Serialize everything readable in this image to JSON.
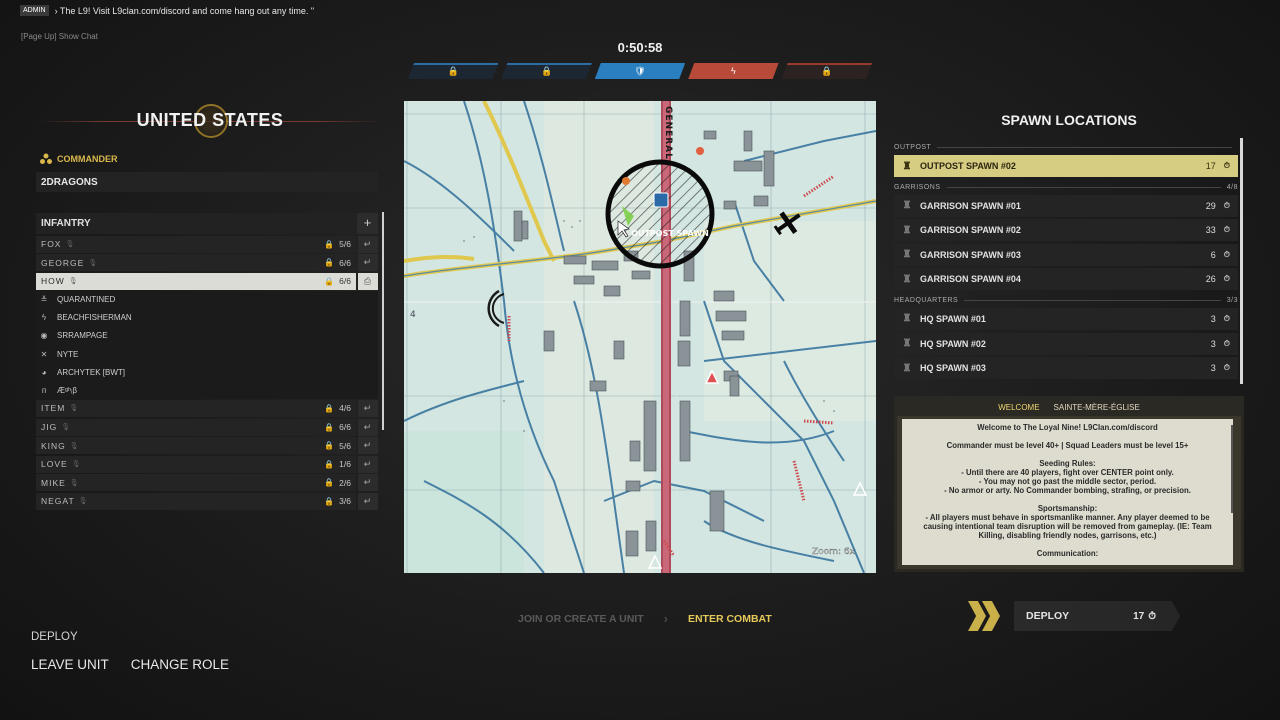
{
  "chat": {
    "badge": "ADMIN",
    "message": "› The L9! Visit L9clan.com/discord and come hang out any time. \"",
    "hint": "[Page Up] Show Chat"
  },
  "match": {
    "timer": "0:50:58",
    "objectives": [
      {
        "owner": "us",
        "icon": "🔒"
      },
      {
        "owner": "us",
        "icon": "🔒"
      },
      {
        "owner": "mid",
        "icon": "🛡"
      },
      {
        "owner": "ger",
        "icon": "ϟ"
      },
      {
        "owner": "enemy",
        "icon": "🔒"
      }
    ],
    "colors": {
      "allied": "#2e6da4",
      "axis": "#b84a3a",
      "accent": "#d9b84c"
    }
  },
  "faction": {
    "title": "UNITED STATES",
    "commander_label": "COMMANDER",
    "commander_name": "2DRAGONS"
  },
  "infantry": {
    "header": "INFANTRY",
    "add_label": "+",
    "units": [
      {
        "name": "FOX",
        "count": "5/6",
        "locked": true
      },
      {
        "name": "GEORGE",
        "count": "6/6",
        "locked": true
      },
      {
        "name": "HOW",
        "count": "6/6",
        "locked": true,
        "selected": true,
        "members": [
          {
            "icon": "chevron-rank-icon",
            "glyph": "≚",
            "name": "QUARANTINED"
          },
          {
            "icon": "lightning-icon",
            "glyph": "ϟ",
            "name": "BEACHFISHERMAN"
          },
          {
            "icon": "eye-icon",
            "glyph": "◉",
            "name": "SRRAMPAGE"
          },
          {
            "icon": "crossed-swords-icon",
            "glyph": "✕",
            "name": "NYTE"
          },
          {
            "icon": "helmet-icon",
            "glyph": "◕",
            "name": "ARCHYTEK [BWT]"
          },
          {
            "icon": "medic-icon",
            "glyph": "ᴨ",
            "name": "Æᵍʰᵢβ"
          }
        ]
      },
      {
        "name": "ITEM",
        "count": "4/6",
        "locked": true
      },
      {
        "name": "JIG",
        "count": "6/6",
        "locked": true
      },
      {
        "name": "KING",
        "count": "5/6",
        "locked": true
      },
      {
        "name": "LOVE",
        "count": "1/6",
        "locked": true
      },
      {
        "name": "MIKE",
        "count": "2/6",
        "locked": true
      },
      {
        "name": "NEGAT",
        "count": "3/6",
        "locked": true
      }
    ]
  },
  "map": {
    "road_label": "GENERAL",
    "objective_label": "OUTPOST SPAWN",
    "zoom_label": "Zoom: 6x",
    "grid_label": "4"
  },
  "spawns": {
    "title": "SPAWN LOCATIONS",
    "sections": [
      {
        "label": "OUTPOST",
        "count": "",
        "items": [
          {
            "name": "OUTPOST SPAWN #02",
            "count": "17",
            "selected": true
          }
        ]
      },
      {
        "label": "GARRISONS",
        "count": "4/8",
        "items": [
          {
            "name": "GARRISON SPAWN #01",
            "count": "29"
          },
          {
            "name": "GARRISON SPAWN #02",
            "count": "33"
          },
          {
            "name": "GARRISON SPAWN #03",
            "count": "6"
          },
          {
            "name": "GARRISON SPAWN #04",
            "count": "26"
          }
        ]
      },
      {
        "label": "HEADQUARTERS",
        "count": "3/3",
        "items": [
          {
            "name": "HQ SPAWN #01",
            "count": "3"
          },
          {
            "name": "HQ SPAWN #02",
            "count": "3"
          },
          {
            "name": "HQ SPAWN #03",
            "count": "3"
          }
        ]
      }
    ]
  },
  "welcome": {
    "tab_welcome": "WELCOME",
    "tab_map": "SAINTE-MÈRE-ÉGLISE",
    "lines": [
      "Welcome to The Loyal Nine! L9Clan.com/discord",
      "",
      "Commander must be level 40+ | Squad Leaders must be level 15+",
      "",
      "Seeding Rules:",
      "- Until there are 40 players, fight over CENTER point only.",
      "- You may not go past the middle sector, period.",
      "- No armor or arty. No Commander bombing, strafing, or precision.",
      "",
      "Sportsmanship:",
      "- All players must behave in sportsmanlike manner. Any player deemed to be causing intentional team disruption will be removed from gameplay. (IE: Team Killing, disabling friendly nodes, garrisons, etc.)",
      "",
      "Communication:"
    ]
  },
  "flow": {
    "step1": "JOIN OR CREATE A UNIT",
    "step2": "ENTER COMBAT"
  },
  "deploy": {
    "label": "DEPLOY",
    "count": "17"
  },
  "bottom": {
    "deploy_label": "DEPLOY",
    "leave_unit": "LEAVE UNIT",
    "change_role": "CHANGE ROLE"
  }
}
